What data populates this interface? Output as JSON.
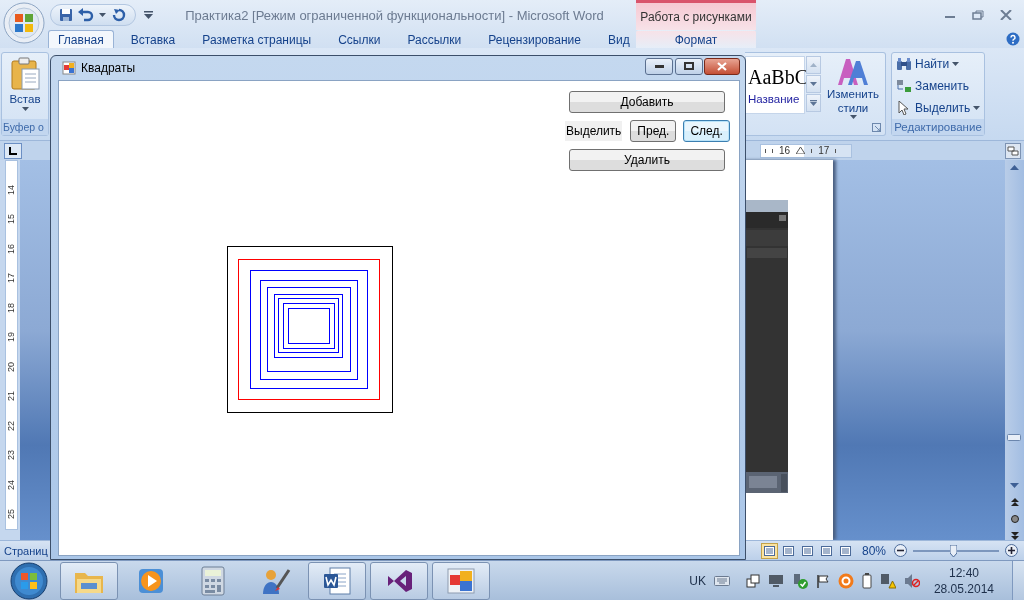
{
  "word": {
    "title": "Практика2 [Режим ограниченной функциональности] - Microsoft Word",
    "contextual_group": "Работа с рисунками",
    "tabs": [
      {
        "label": "Главная",
        "selected": true,
        "kind": "standard"
      },
      {
        "label": "Вставка",
        "selected": false,
        "kind": "standard"
      },
      {
        "label": "Разметка страницы",
        "selected": false,
        "kind": "standard"
      },
      {
        "label": "Ссылки",
        "selected": false,
        "kind": "standard"
      },
      {
        "label": "Рассылки",
        "selected": false,
        "kind": "standard"
      },
      {
        "label": "Рецензирование",
        "selected": false,
        "kind": "standard"
      },
      {
        "label": "Вид",
        "selected": false,
        "kind": "standard"
      },
      {
        "label": "Формат",
        "selected": false,
        "kind": "contextual"
      }
    ],
    "ribbon": {
      "clipboard": {
        "paste": "Встав",
        "group_label": "Буфер о"
      },
      "styles": {
        "sample": "AaBbC",
        "style_name": "Название",
        "change_styles": "Изменить стили"
      },
      "editing": {
        "items": [
          {
            "label": "Найти",
            "kind": "find",
            "dropdown": true
          },
          {
            "label": "Заменить",
            "kind": "replace",
            "dropdown": false
          },
          {
            "label": "Выделить",
            "kind": "select",
            "dropdown": true
          }
        ],
        "group_label": "Редактирование"
      }
    },
    "horizontal_ruler": [
      "16",
      "17"
    ],
    "vertical_ruler": [
      "14",
      "15",
      "16",
      "17",
      "18",
      "19",
      "20",
      "21",
      "22",
      "23",
      "24",
      "25"
    ],
    "status_bar": {
      "page": "Страниц",
      "zoom": "80%",
      "zoom_slider": {
        "level": 0.47
      }
    }
  },
  "form": {
    "title": "Квадраты",
    "add_button": {
      "label": "Добавить",
      "focused": false
    },
    "select_label": "Выделить",
    "select_buttons": [
      {
        "label": "Пред.",
        "focused": false
      },
      {
        "label": "След.",
        "focused": true
      }
    ],
    "delete_button": {
      "label": "Удалить",
      "focused": false
    }
  },
  "taskbar": {
    "apps": [
      {
        "kind": "folder",
        "running": true
      },
      {
        "kind": "media",
        "running": false
      },
      {
        "kind": "calculator",
        "running": false
      },
      {
        "kind": "brush",
        "running": false
      },
      {
        "kind": "document",
        "running": true
      },
      {
        "kind": "loop",
        "running": true
      },
      {
        "kind": "squares",
        "running": true
      }
    ],
    "language": "UK",
    "time": "12:40",
    "date": "28.05.2014"
  }
}
